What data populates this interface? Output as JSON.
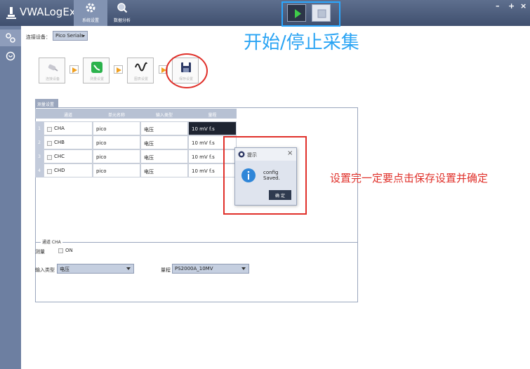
{
  "app": {
    "title": "VWALogEx"
  },
  "nav": {
    "tabs": [
      {
        "label": "系统设置",
        "active": true
      },
      {
        "label": "数据分析",
        "active": false
      }
    ]
  },
  "window_controls": {
    "minimize": "–",
    "maximize": "+",
    "close": "×"
  },
  "device": {
    "label": "连接设备：",
    "selected": "Pico Serials"
  },
  "overlay": {
    "title": "开始/停止采集",
    "instruction": "设置完一定要点击保存设置并确定"
  },
  "workflow": {
    "steps": [
      {
        "label": "连接设备"
      },
      {
        "label": "测量设置"
      },
      {
        "label": "图表设置"
      },
      {
        "label": "保存设置"
      }
    ]
  },
  "measure": {
    "tab_label": "测量设置",
    "columns": [
      "通道",
      "单元名称",
      "输入类型",
      "量程"
    ],
    "rows": [
      {
        "num": "1",
        "channel": "CHA",
        "unit": "pico",
        "input_type": "电压",
        "range": "10 mV f.s"
      },
      {
        "num": "2",
        "channel": "CHB",
        "unit": "pico",
        "input_type": "电压",
        "range": "10 mV f.s"
      },
      {
        "num": "3",
        "channel": "CHC",
        "unit": "pico",
        "input_type": "电压",
        "range": "10 mV f.s"
      },
      {
        "num": "4",
        "channel": "CHD",
        "unit": "pico",
        "input_type": "电压",
        "range": "10 mV f.s"
      }
    ]
  },
  "channel_detail": {
    "group_title": "通道 CHA",
    "measure_label": "测量",
    "on_label": "ON",
    "input_type_label": "输入类型",
    "input_type_value": "电压",
    "range_label": "量程",
    "range_value": "PS2000A_10MV"
  },
  "dialog": {
    "title": "提示",
    "message": "config Saved.",
    "ok_label": "确 定"
  },
  "colors": {
    "accent_blue": "#2aa4f4",
    "annotation_red": "#e0302a",
    "titlebar": "#4f5f7e"
  }
}
